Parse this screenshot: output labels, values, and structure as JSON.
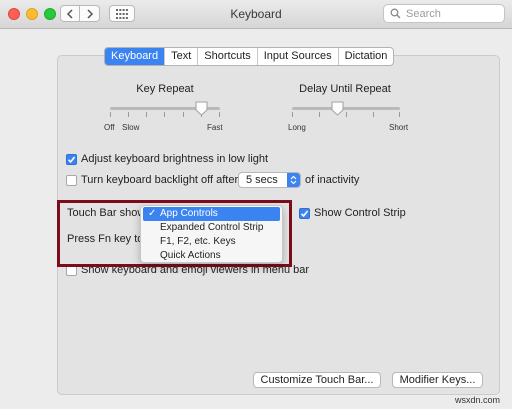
{
  "window": {
    "title": "Keyboard",
    "search_placeholder": "Search"
  },
  "tabs": [
    {
      "label": "Keyboard",
      "active": true
    },
    {
      "label": "Text",
      "active": false
    },
    {
      "label": "Shortcuts",
      "active": false
    },
    {
      "label": "Input Sources",
      "active": false
    },
    {
      "label": "Dictation",
      "active": false
    }
  ],
  "key_repeat": {
    "label": "Key Repeat",
    "min_label": "Off",
    "slow_label": "Slow",
    "max_label": "Fast",
    "value_fraction": 0.83
  },
  "delay_until_repeat": {
    "label": "Delay Until Repeat",
    "min_label": "Long",
    "max_label": "Short",
    "value_fraction": 0.42
  },
  "options": {
    "adjust_brightness": {
      "label": "Adjust keyboard brightness in low light",
      "checked": true
    },
    "backlight_off": {
      "label": "Turn keyboard backlight off after",
      "checked": false,
      "value": "5 secs",
      "suffix": "of inactivity"
    },
    "touch_bar_shows": {
      "label": "Touch Bar shows"
    },
    "show_control_strip": {
      "label": "Show Control Strip",
      "checked": true
    },
    "press_fn": {
      "label": "Press Fn key to"
    },
    "show_viewers": {
      "label": "Show keyboard and emoji viewers in menu bar",
      "checked": false
    }
  },
  "touch_bar_menu": {
    "items": [
      "App Controls",
      "Expanded Control Strip",
      "F1, F2, etc. Keys",
      "Quick Actions"
    ],
    "selected": "App Controls"
  },
  "buttons": {
    "customize": "Customize Touch Bar...",
    "modifier": "Modifier Keys..."
  },
  "watermark": "wsxdn.com",
  "colors": {
    "accent": "#3b83f0",
    "highlight_box": "#7d0c1b"
  }
}
